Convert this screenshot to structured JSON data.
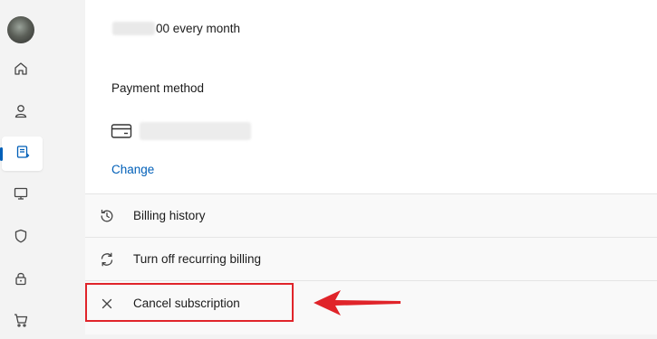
{
  "sidebar": {
    "items": [
      {
        "icon": "home-icon"
      },
      {
        "icon": "person-icon"
      },
      {
        "icon": "subscriptions-icon",
        "active": true
      },
      {
        "icon": "devices-icon"
      },
      {
        "icon": "shield-icon"
      },
      {
        "icon": "lock-icon"
      },
      {
        "icon": "cart-icon"
      }
    ],
    "accent_color": "#005fb8"
  },
  "subscription": {
    "price_suffix": "00 every month",
    "payment_method_label": "Payment method",
    "change_label": "Change"
  },
  "actions": [
    {
      "label": "Billing history",
      "icon": "history-icon"
    },
    {
      "label": "Turn off recurring billing",
      "icon": "refresh-icon"
    },
    {
      "label": "Cancel subscription",
      "icon": "close-icon"
    }
  ],
  "annotation": {
    "color": "#e0242a"
  }
}
